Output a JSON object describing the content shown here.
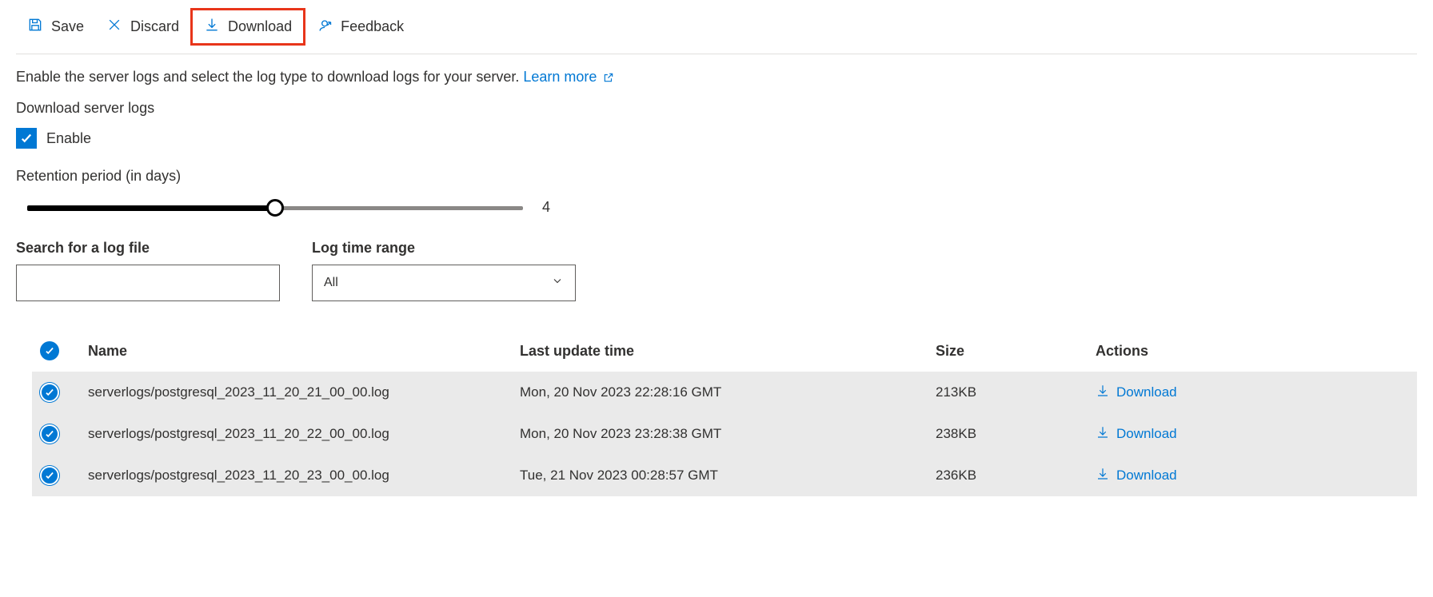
{
  "toolbar": {
    "save_label": "Save",
    "discard_label": "Discard",
    "download_label": "Download",
    "feedback_label": "Feedback"
  },
  "description_text": "Enable the server logs and select the log type to download logs for your server.",
  "learn_more_label": "Learn more",
  "download_section_label": "Download server logs",
  "enable_label": "Enable",
  "retention_label": "Retention period (in days)",
  "retention_value": "4",
  "search_label": "Search for a log file",
  "search_value": "",
  "time_range_label": "Log time range",
  "time_range_value": "All",
  "table": {
    "headers": {
      "name": "Name",
      "last_update": "Last update time",
      "size": "Size",
      "actions": "Actions"
    },
    "action_label": "Download",
    "rows": [
      {
        "name": "serverlogs/postgresql_2023_11_20_21_00_00.log",
        "last_update": "Mon, 20 Nov 2023 22:28:16 GMT",
        "size": "213KB"
      },
      {
        "name": "serverlogs/postgresql_2023_11_20_22_00_00.log",
        "last_update": "Mon, 20 Nov 2023 23:28:38 GMT",
        "size": "238KB"
      },
      {
        "name": "serverlogs/postgresql_2023_11_20_23_00_00.log",
        "last_update": "Tue, 21 Nov 2023 00:28:57 GMT",
        "size": "236KB"
      }
    ]
  }
}
